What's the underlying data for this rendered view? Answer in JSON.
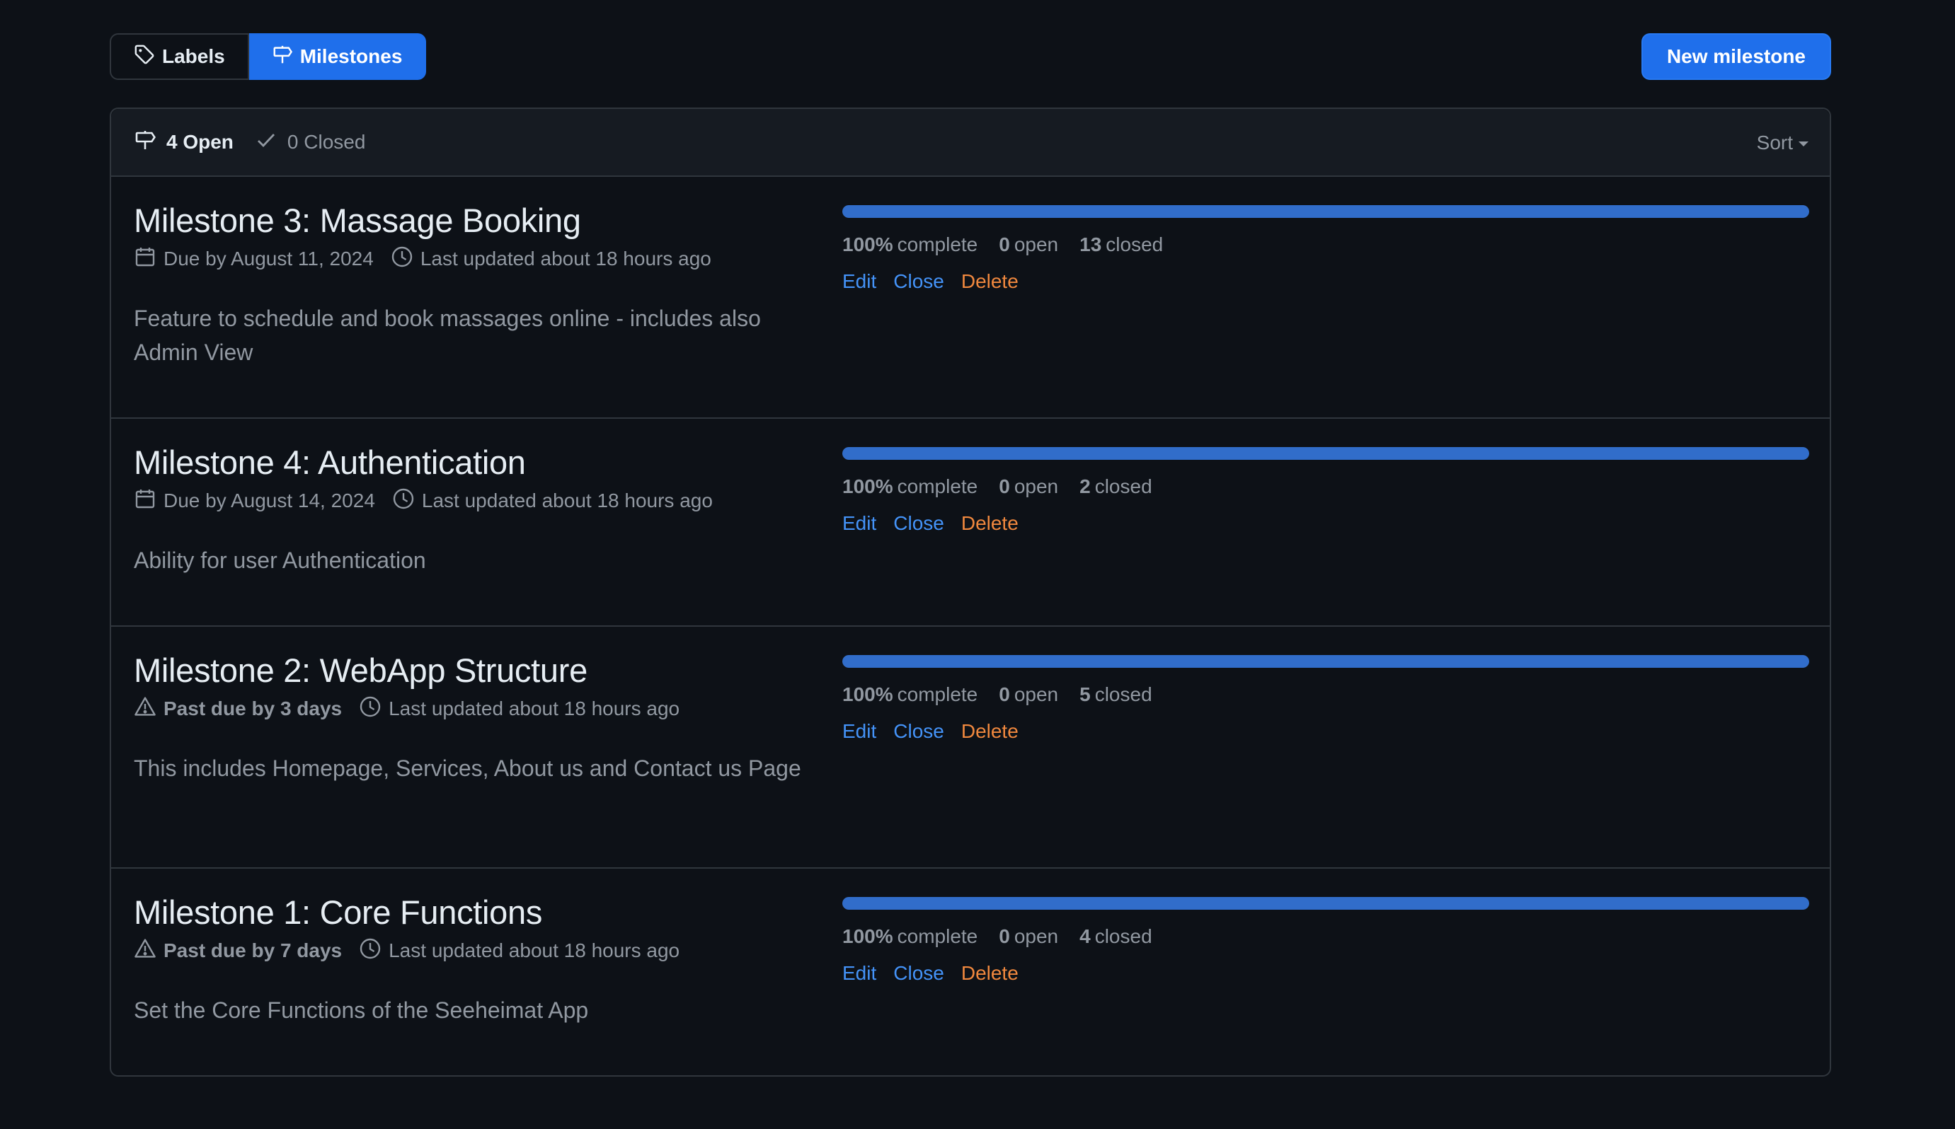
{
  "subnav": {
    "labels": "Labels",
    "milestones": "Milestones"
  },
  "new_milestone_label": "New milestone",
  "header": {
    "open": "4 Open",
    "closed": "0 Closed",
    "sort": "Sort"
  },
  "colors": {
    "accent": "#1f6feb",
    "progress": "#316dca",
    "delete": "#f0883e",
    "link": "#4493f8"
  },
  "milestones": [
    {
      "title": "Milestone 3: Massage Booking",
      "due_icon": "calendar-icon",
      "due": "Due by August 11, 2024",
      "updated": "Last updated about 18 hours ago",
      "description": "Feature to schedule and book massages online - includes also Admin View",
      "progress_percent": 100,
      "pct_value": "100%",
      "pct_label": "complete",
      "open_count": "0",
      "open_label": "open",
      "closed_count": "13",
      "closed_label": "closed",
      "edit": "Edit",
      "close": "Close",
      "delete": "Delete"
    },
    {
      "title": "Milestone 4: Authentication",
      "due_icon": "calendar-icon",
      "due": "Due by August 14, 2024",
      "updated": "Last updated about 18 hours ago",
      "description": "Ability for user Authentication",
      "progress_percent": 100,
      "pct_value": "100%",
      "pct_label": "complete",
      "open_count": "0",
      "open_label": "open",
      "closed_count": "2",
      "closed_label": "closed",
      "edit": "Edit",
      "close": "Close",
      "delete": "Delete"
    },
    {
      "title": "Milestone 2: WebApp Structure",
      "due_icon": "alert-icon",
      "due": "Past due by 3 days",
      "updated": "Last updated about 18 hours ago",
      "description": "This includes Homepage, Services, About us and Contact us Page",
      "progress_percent": 100,
      "pct_value": "100%",
      "pct_label": "complete",
      "open_count": "0",
      "open_label": "open",
      "closed_count": "5",
      "closed_label": "closed",
      "edit": "Edit",
      "close": "Close",
      "delete": "Delete"
    },
    {
      "title": "Milestone 1: Core Functions",
      "due_icon": "alert-icon",
      "due": "Past due by 7 days",
      "updated": "Last updated about 18 hours ago",
      "description": "Set the Core Functions of the Seeheimat App",
      "progress_percent": 100,
      "pct_value": "100%",
      "pct_label": "complete",
      "open_count": "0",
      "open_label": "open",
      "closed_count": "4",
      "closed_label": "closed",
      "edit": "Edit",
      "close": "Close",
      "delete": "Delete"
    }
  ]
}
